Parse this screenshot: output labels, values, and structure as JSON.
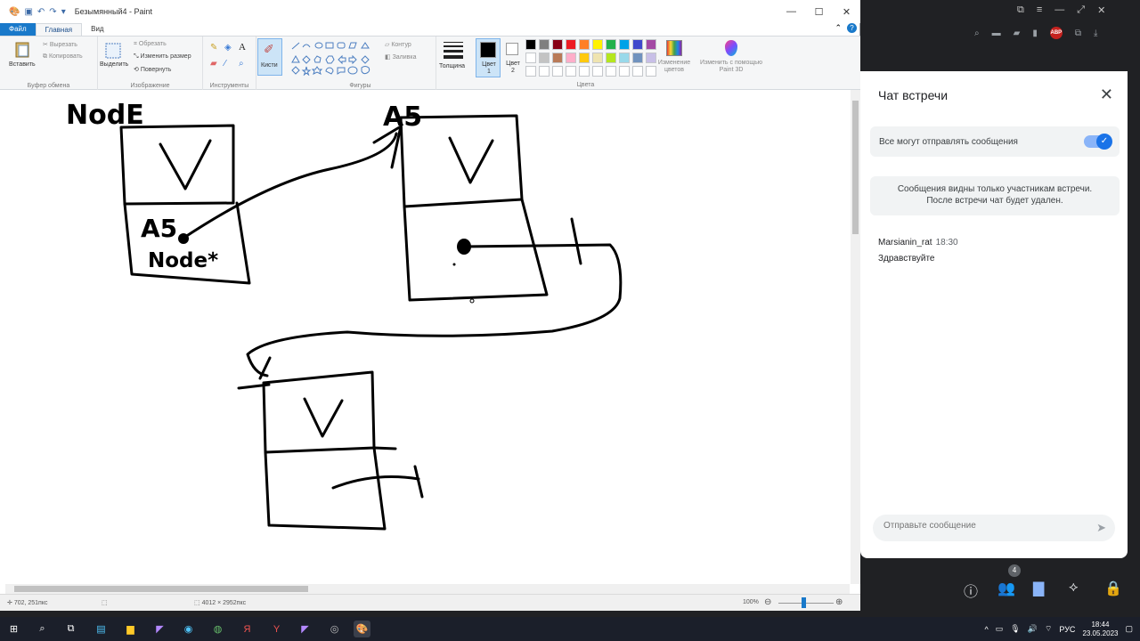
{
  "paint": {
    "title": "Безымянный4 - Paint",
    "tabs": {
      "file": "Файл",
      "home": "Главная",
      "view": "Вид"
    },
    "ribbon": {
      "clipboard": {
        "paste": "Вставить",
        "cut": "Вырезать",
        "copy": "Копировать",
        "label": "Буфер обмена"
      },
      "image": {
        "select": "Выделить",
        "crop": "Обрезать",
        "resize": "Изменить размер",
        "rotate": "Повернуть",
        "label": "Изображение"
      },
      "tools": {
        "label": "Инструменты"
      },
      "brushes": {
        "label": "Кисти"
      },
      "shapes": {
        "outline": "Контур",
        "fill": "Заливка",
        "label": "Фигуры"
      },
      "size": {
        "label": "Толщина"
      },
      "color1": {
        "label": "Цвет 1"
      },
      "color2": {
        "label": "Цвет 2"
      },
      "colors": {
        "edit": "Изменение цветов",
        "label": "Цвета"
      },
      "paint3d": {
        "label": "Изменить с помощью Paint 3D"
      }
    },
    "palette": [
      "#000000",
      "#7f7f7f",
      "#880015",
      "#ed1c24",
      "#ff7f27",
      "#fff200",
      "#22b14c",
      "#00a2e8",
      "#3f48cc",
      "#a349a4",
      "#ffffff",
      "#c3c3c3",
      "#b97a57",
      "#ffaec9",
      "#ffc90e",
      "#efe4b0",
      "#b5e61d",
      "#99d9ea",
      "#7092be",
      "#c8bfe7",
      "#ffffff",
      "#ffffff",
      "#ffffff",
      "#ffffff",
      "#ffffff",
      "#ffffff",
      "#ffffff",
      "#ffffff",
      "#ffffff",
      "#ffffff"
    ],
    "canvas_text": {
      "node": "NodE",
      "a5_top": "A5",
      "v1": "V",
      "v2": "V",
      "v3": "V",
      "a5_inner": "A5",
      "nodestar": "Node*"
    },
    "status": {
      "cursor": "702, 251пкс",
      "size": "4012 × 2952пкс",
      "zoom": "100%"
    }
  },
  "chat": {
    "title": "Чат встречи",
    "toggle_label": "Все могут отправлять сообщения",
    "info_line1": "Сообщения видны только участникам встречи.",
    "info_line2": "После встречи чат будет удален.",
    "messages": [
      {
        "author": "Marsianin_rat",
        "time": "18:30",
        "text": "Здравствуйте"
      }
    ],
    "input_placeholder": "Отправьте сообщение",
    "participants_count": "4"
  },
  "taskbar": {
    "lang": "РУС",
    "time": "18:44",
    "date": "23.05.2023"
  }
}
